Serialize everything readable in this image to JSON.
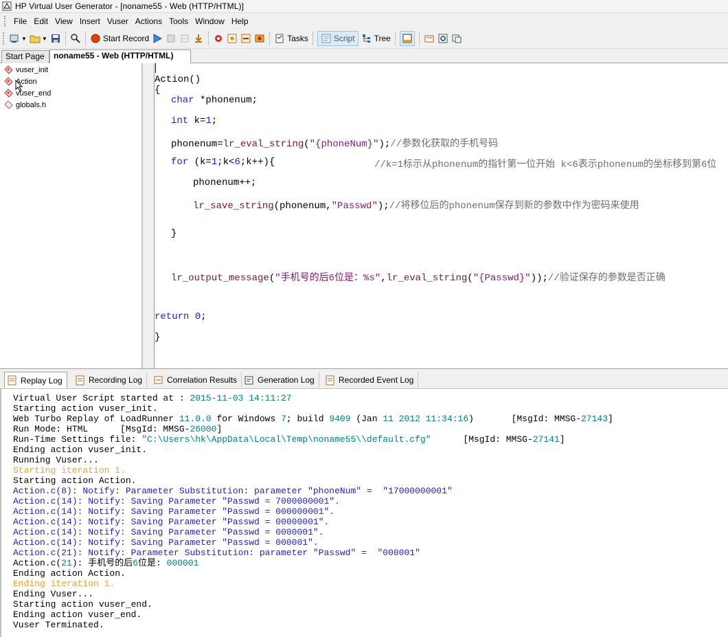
{
  "window": {
    "title": "HP Virtual User Generator - [noname55 - Web (HTTP/HTML)]"
  },
  "menu": [
    "File",
    "Edit",
    "View",
    "Insert",
    "Vuser",
    "Actions",
    "Tools",
    "Window",
    "Help"
  ],
  "toolbar": {
    "start_record": "Start Record",
    "tasks": "Tasks",
    "script": "Script",
    "tree": "Tree"
  },
  "tabs": {
    "start_page": "Start Page",
    "script_tab": "noname55 - Web (HTTP/HTML)"
  },
  "tree": [
    "vuser_init",
    "Action",
    "vuser_end",
    "globals.h"
  ],
  "code": {
    "l1": "Action()",
    "l2": "{",
    "l3a": "char",
    "l3b": " *phonenum;",
    "l4a": "int",
    "l4b": " k=",
    "l4c": "1",
    "l4d": ";",
    "l5a": "phonenum=",
    "l5b": "lr_eval_string",
    "l5c": "(",
    "l5d": "\"{phoneNum}\"",
    "l5e": ");",
    "l5f": "//参数化获取的手机号码",
    "l6a": "for",
    "l6b": " (k=",
    "l6c": "1",
    "l6d": ";k<",
    "l6e": "6",
    "l6f": ";k++){",
    "l6g": "//k=1标示从phonenum的指针第一位开始 k<6表示phonenum的坐标移到第6位",
    "l7": "phonenum++;",
    "l8a": "lr_save_string",
    "l8b": "(phonenum,",
    "l8c": "\"Passwd\"",
    "l8d": ");",
    "l8e": "//将移位后的phonenum保存到新的参数中作为密码来使用",
    "l9": "}",
    "l10a": "lr_output_message",
    "l10b": "(",
    "l10c": "\"手机号的后6位是：%s\"",
    "l10d": ",",
    "l10e": "lr_eval_string",
    "l10f": "(",
    "l10g": "\"{Passwd}\"",
    "l10h": "));",
    "l10i": "//验证保存的参数是否正确",
    "l11a": "return",
    "l11b": " ",
    "l11c": "0",
    "l11d": ";",
    "l12": "}"
  },
  "log_tabs": [
    "Replay Log",
    "Recording Log",
    "Correlation Results",
    "Generation Log",
    "Recorded Event Log"
  ],
  "log": {
    "r1a": "Virtual User Script started at : ",
    "r1b": "2015-11-03 14:11:27",
    "r2": "Starting action vuser_init.",
    "r3a": "Web Turbo Replay of LoadRunner ",
    "r3b": "11.0.0",
    "r3c": " for Windows ",
    "r3d": "7",
    "r3e": "; build ",
    "r3f": "9409",
    "r3g": " (Jan ",
    "r3h": "11 2012 11:34:16",
    "r3i": ")       [MsgId: MMSG-",
    "r3j": "27143",
    "r3k": "]",
    "r4a": "Run Mode: HTML      [MsgId: MMSG-",
    "r4b": "26000",
    "r4c": "]",
    "r5a": "Run-Time Settings file: ",
    "r5b": "\"C:\\Users\\hk\\AppData\\Local\\Temp\\noname55\\\\default.cfg\"",
    "r5c": "      [MsgId: MMSG-",
    "r5d": "27141",
    "r5e": "]",
    "r6": "Ending action vuser_init.",
    "r7": "Running Vuser...",
    "r8": "Starting iteration 1.",
    "r9": "Starting action Action.",
    "r10": "Action.c(8): Notify: Parameter Substitution: parameter \"phoneNum\" =  \"17000000001\"",
    "r11": "Action.c(14): Notify: Saving Parameter \"Passwd = 7000000001\".",
    "r12": "Action.c(14): Notify: Saving Parameter \"Passwd = 000000001\".",
    "r13": "Action.c(14): Notify: Saving Parameter \"Passwd = 00000001\".",
    "r14": "Action.c(14): Notify: Saving Parameter \"Passwd = 0000001\".",
    "r15": "Action.c(14): Notify: Saving Parameter \"Passwd = 000001\".",
    "r16": "Action.c(21): Notify: Parameter Substitution: parameter \"Passwd\" =  \"000001\"",
    "r17a": "Action.c(",
    "r17b": "21",
    "r17c": "): 手机号的后",
    "r17d": "6",
    "r17e": "位是: ",
    "r17f": "000001",
    "r18": "Ending action Action.",
    "r19": "Ending iteration 1.",
    "r20": "Ending Vuser...",
    "r21": "Starting action vuser_end.",
    "r22": "Ending action vuser_end.",
    "r23": "Vuser Terminated."
  }
}
